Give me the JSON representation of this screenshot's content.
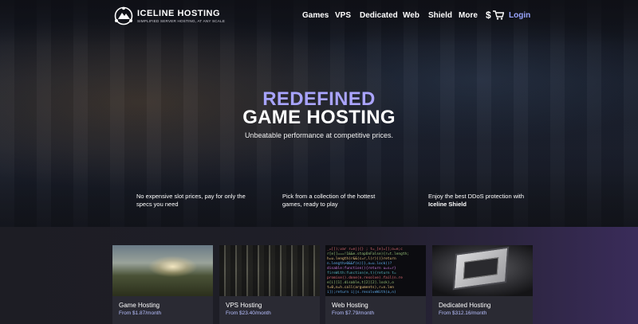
{
  "brand": {
    "name": "ICELINE HOSTING",
    "tagline": "SIMPLIFIED SERVER HOSTING, AT ANY SCALE"
  },
  "nav": {
    "items": [
      "Games",
      "VPS",
      "Dedicated",
      "Web",
      "Shield",
      "More"
    ],
    "cart_symbol": "$",
    "login": "Login"
  },
  "hero": {
    "headline_accent": "REDEFINED",
    "headline_main": "GAME HOSTING",
    "subtitle": "Unbeatable performance at competitive prices."
  },
  "features": [
    {
      "text": "No expensive slot prices, pay for only the specs you need"
    },
    {
      "text": "Pick from a collection of the hottest games, ready to play"
    },
    {
      "text": "Enjoy the best DDoS protection with",
      "bold": "Iceline Shield"
    }
  ],
  "cards": [
    {
      "title": "Game Hosting",
      "price": "From $1.87/month"
    },
    {
      "title": "VPS Hosting",
      "price": "From $23.40/month"
    },
    {
      "title": "Web Hosting",
      "price": "From $7.79/month"
    },
    {
      "title": "Dedicated Hosting",
      "price": "From $312.16/month"
    }
  ],
  "colors": {
    "accent": "#9aa6ff",
    "background": "#1b1b22",
    "card": "#2a2a33"
  }
}
